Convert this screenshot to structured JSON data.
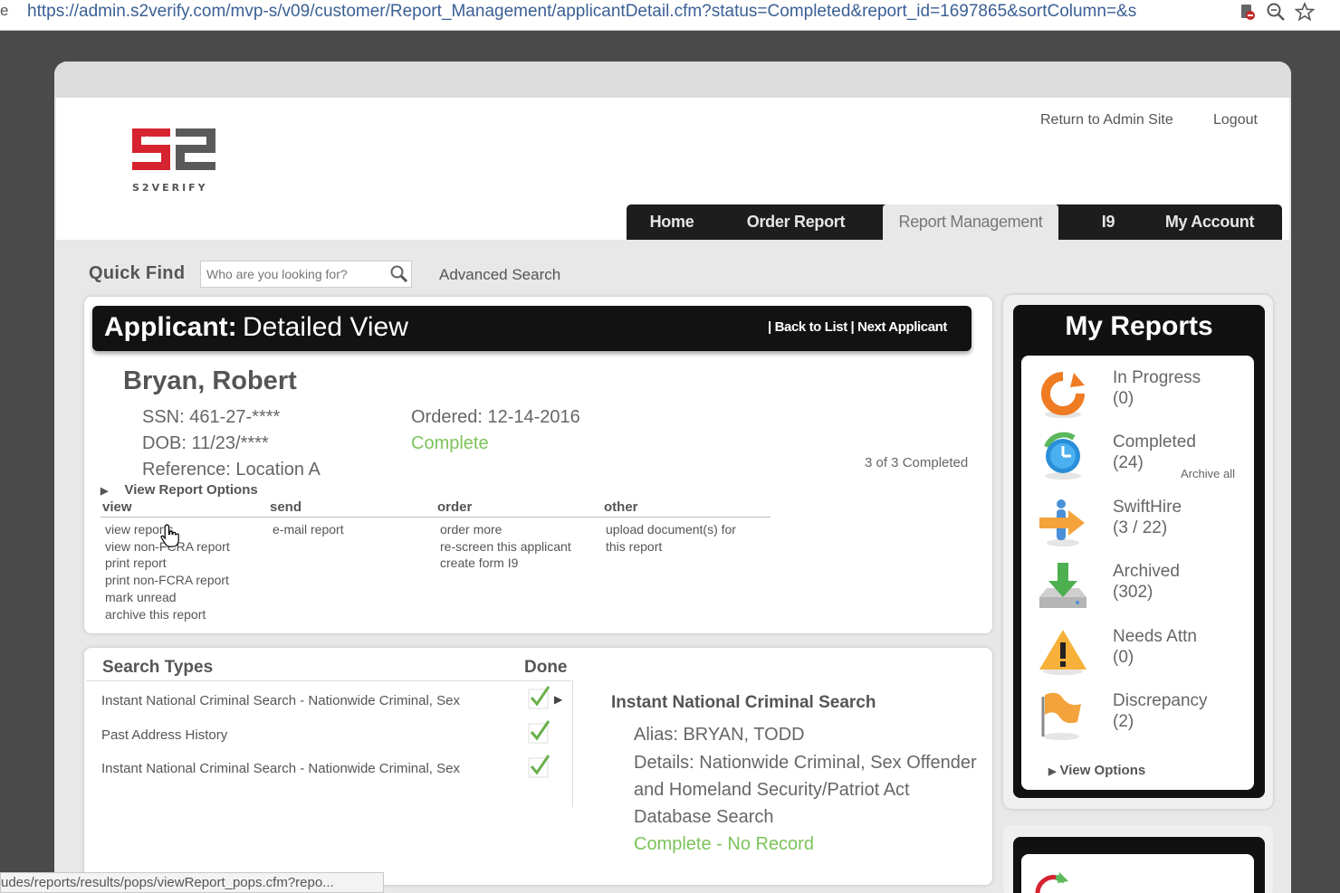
{
  "browser": {
    "tab_edge": "e",
    "url": "https://admin.s2verify.com/mvp-s/v09/customer/Report_Management/applicantDetail.cfm?status=Completed&report_id=1697865&sortColumn=&s",
    "icons": [
      "blocked-content-icon",
      "zoom-icon",
      "bookmark-star-icon"
    ],
    "status_url": "udes/reports/results/pops/viewReport_pops.cfm?repo..."
  },
  "header": {
    "logo_text": "S2VERIFY",
    "links": [
      "Return to Admin Site",
      "Logout"
    ],
    "nav": [
      "Home",
      "Order Report",
      "Report Management",
      "I9",
      "My Account"
    ],
    "active_nav": "Report Management"
  },
  "quick_find": {
    "label": "Quick Find",
    "placeholder": "Who are you looking for?",
    "advanced": "Advanced Search"
  },
  "applicant": {
    "title_bold": "Applicant:",
    "title_rest": "Detailed View",
    "links": [
      "| Back to List |",
      "Next Applicant"
    ],
    "name": "Bryan, Robert",
    "ssn": "SSN: 461-27-****",
    "dob": "DOB: 11/23/****",
    "reference": "Reference: Location A",
    "ordered": "Ordered: 12-14-2016",
    "status": "Complete",
    "completed_count": "3 of 3 Completed",
    "view_report_options": "View Report Options",
    "option_columns": [
      {
        "header": "view",
        "items": [
          "view reports",
          "view non-FCRA report",
          "print report",
          "print non-FCRA report",
          "mark unread",
          "archive this report"
        ]
      },
      {
        "header": "send",
        "items": [
          "e-mail report"
        ]
      },
      {
        "header": "order",
        "items": [
          "order more",
          "re-screen this applicant",
          "create form I9"
        ]
      },
      {
        "header": "other",
        "items": [
          "upload document(s) for",
          "this report"
        ]
      }
    ]
  },
  "search_types": {
    "header": "Search Types",
    "done_header": "Done",
    "rows": [
      "Instant National Criminal Search - Nationwide Criminal, Sex",
      "Past Address History",
      "Instant National Criminal Search - Nationwide Criminal, Sex"
    ],
    "detail": {
      "title": "Instant National Criminal Search",
      "alias": "Alias: BRYAN, TODD",
      "details_lines": [
        "Details: Nationwide Criminal, Sex Offender",
        "and Homeland Security/Patriot Act",
        "Database Search"
      ],
      "status": "Complete - No Record"
    }
  },
  "my_reports": {
    "title": "My Reports",
    "items": [
      {
        "label": "In Progress",
        "count": "(0)",
        "icon": "refresh-icon"
      },
      {
        "label": "Completed",
        "count": "(24)",
        "icon": "clock-icon"
      },
      {
        "label": "SwiftHire",
        "count": "(3 / 22)",
        "icon": "person-arrow-icon"
      },
      {
        "label": "Archived",
        "count": "(302)",
        "icon": "download-tray-icon"
      },
      {
        "label": "Needs Attn",
        "count": "(0)",
        "icon": "warning-icon"
      },
      {
        "label": "Discrepancy",
        "count": "(2)",
        "icon": "flag-icon"
      }
    ],
    "archive_all": "Archive all",
    "view_options": "View Options"
  },
  "colors": {
    "status_green": "#7cc35a",
    "nav_dark": "#1d1d1d",
    "logo_red": "#d5232f",
    "logo_gray": "#5a5a5a"
  }
}
